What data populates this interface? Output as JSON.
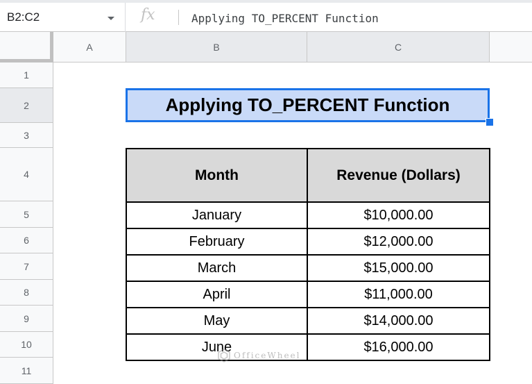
{
  "formula_bar": {
    "name_box": "B2:C2",
    "fx_label": "fx",
    "formula": "Applying TO_PERCENT Function"
  },
  "columns": [
    "A",
    "B",
    "C"
  ],
  "rows": [
    "1",
    "2",
    "3",
    "4",
    "5",
    "6",
    "7",
    "8",
    "9",
    "10",
    "11"
  ],
  "sheet": {
    "title": "Applying TO_PERCENT Function",
    "table": {
      "headers": [
        "Month",
        "Revenue (Dollars)"
      ],
      "rows": [
        [
          "January",
          "$10,000.00"
        ],
        [
          "February",
          "$12,000.00"
        ],
        [
          "March",
          "$15,000.00"
        ],
        [
          "April",
          "$11,000.00"
        ],
        [
          "May",
          "$14,000.00"
        ],
        [
          "June",
          "$16,000.00"
        ]
      ]
    }
  },
  "watermark": "OfficeWheel",
  "colors": {
    "selection": "#1a73e8",
    "selection_fill": "#c9daf8",
    "header_fill": "#d9d9d9"
  }
}
